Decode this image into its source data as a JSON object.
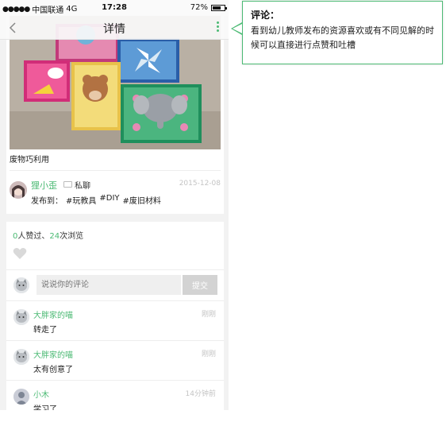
{
  "status_bar": {
    "carrier": "中国联通",
    "network": "4G",
    "time": "17:28",
    "battery": "72%",
    "battery_level": 0.72
  },
  "nav": {
    "title": "详情"
  },
  "post": {
    "caption": "废物巧利用",
    "author": "狸小歪",
    "chat_label": "私聊",
    "date": "2015-12-08",
    "publish_label": "发布到：",
    "tags": [
      "#玩教具",
      "#DIY",
      "#废旧材料"
    ]
  },
  "stats": {
    "likes": "0",
    "likes_suffix": "人赞过、",
    "views": "24",
    "views_suffix": "次浏览"
  },
  "comment_box": {
    "placeholder": "说说你的评论",
    "submit_label": "提交"
  },
  "comments": [
    {
      "name": "大胖家的喵",
      "time": "刚刚",
      "text": "转走了"
    },
    {
      "name": "大胖家的喵",
      "time": "刚刚",
      "text": "太有创意了"
    },
    {
      "name": "小木",
      "time": "14分钟前",
      "text": "学习了"
    }
  ],
  "annotation": {
    "title": "评论：",
    "body": "看到幼儿教师发布的资源喜欢或有不同见解的时候可以直接进行点赞和吐槽"
  },
  "colors": {
    "accent": "#4cba74",
    "muted": "#c4c4c4"
  }
}
